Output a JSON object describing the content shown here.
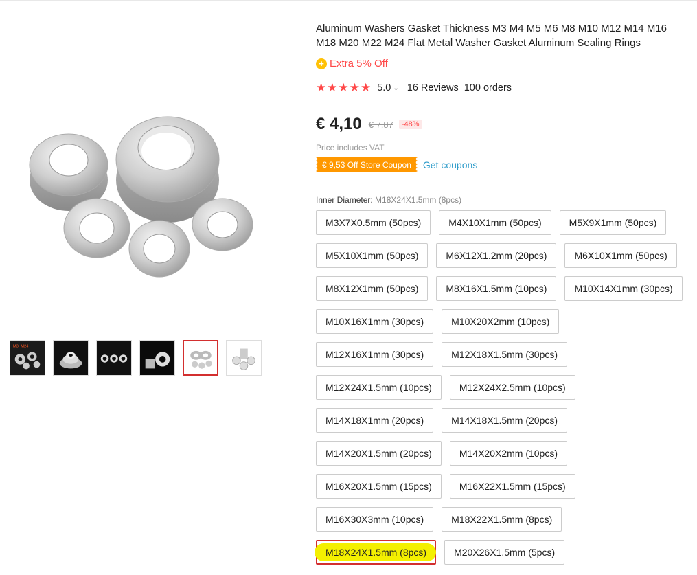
{
  "product": {
    "title": "Aluminum Washers Gasket Thickness M3 M4 M5 M6 M8 M10 M12 M14 M16 M18 M20 M22 M24 Flat Metal Washer Gasket Aluminum Sealing Rings",
    "promo_icon": "coin-icon",
    "promo_text": "Extra 5% Off",
    "stars": "★★★★★",
    "rating": "5.0",
    "reviews": "16 Reviews",
    "orders": "100 orders",
    "price": "€ 4,10",
    "old_price": "€ 7,87",
    "discount": "-48%",
    "vat_note": "Price includes VAT",
    "coupon": "€ 9,53 Off Store Coupon",
    "get_coupons": "Get coupons",
    "sku_label": "Inner Diameter:",
    "sku_value": "M18X24X1.5mm (8pcs)"
  },
  "colors": {
    "accent": "#ff4747",
    "selected_border": "#d32f2f",
    "coupon": "#ff9800",
    "link": "#2e9cca",
    "highlight": "#f4f000"
  },
  "gallery": {
    "thumbs": [
      {
        "label": "M3~M24"
      },
      {
        "label": ""
      },
      {
        "label": ""
      },
      {
        "label": ""
      },
      {
        "label": ""
      },
      {
        "label": ""
      }
    ],
    "active_index": 4
  },
  "options": [
    [
      "M3X7X0.5mm (50pcs)",
      "M4X10X1mm (50pcs)",
      "M5X9X1mm (50pcs)"
    ],
    [
      "M5X10X1mm (50pcs)",
      "M6X12X1.2mm (20pcs)",
      "M6X10X1mm (50pcs)"
    ],
    [
      "M8X12X1mm (50pcs)",
      "M8X16X1.5mm (10pcs)",
      "M10X14X1mm (30pcs)"
    ],
    [
      "M10X16X1mm (30pcs)",
      "M10X20X2mm (10pcs)"
    ],
    [
      "M12X16X1mm (30pcs)",
      "M12X18X1.5mm (30pcs)"
    ],
    [
      "M12X24X1.5mm (10pcs)",
      "M12X24X2.5mm (10pcs)"
    ],
    [
      "M14X18X1mm (20pcs)",
      "M14X18X1.5mm (20pcs)"
    ],
    [
      "M14X20X1.5mm (20pcs)",
      "M14X20X2mm (10pcs)"
    ],
    [
      "M16X20X1.5mm (15pcs)",
      "M16X22X1.5mm (15pcs)"
    ],
    [
      "M16X30X3mm (10pcs)",
      "M18X22X1.5mm (8pcs)"
    ],
    [
      "M18X24X1.5mm (8pcs)",
      "M20X26X1.5mm (5pcs)"
    ]
  ],
  "selected_option": "M18X24X1.5mm (8pcs)"
}
